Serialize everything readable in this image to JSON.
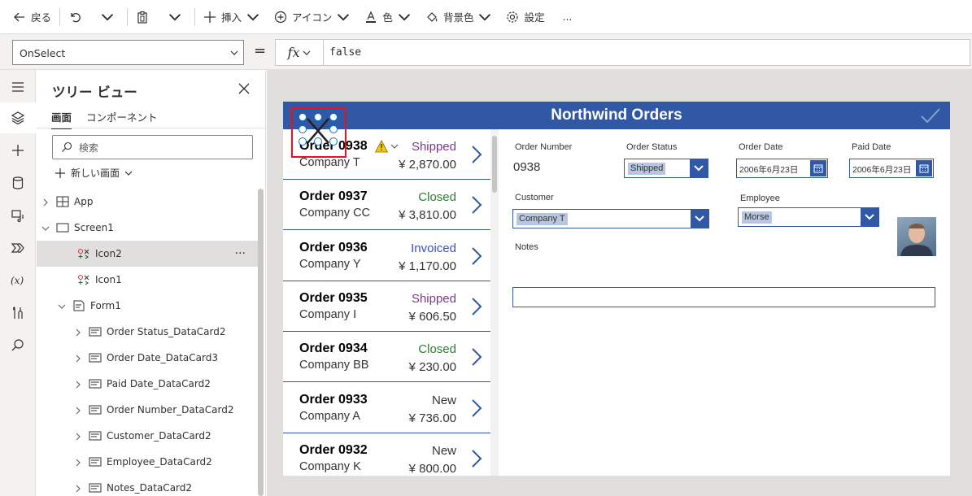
{
  "toolbar": {
    "back": "戻る",
    "insert": "挿入",
    "icon": "アイコン",
    "color": "色",
    "bgcolor": "背景色",
    "settings": "設定",
    "more": "..."
  },
  "formula_bar": {
    "property": "OnSelect",
    "equals": "=",
    "fx": "fx",
    "formula": "false"
  },
  "tree": {
    "title": "ツリー ビュー",
    "tabs": [
      "画面",
      "コンポーネント"
    ],
    "search_placeholder": "検索",
    "new_screen": "新しい画面",
    "nodes": [
      {
        "label": "App",
        "level": 0,
        "expander": "collapsed",
        "icon": "app-icon"
      },
      {
        "label": "Screen1",
        "level": 0,
        "expander": "expanded",
        "icon": "screen-icon"
      },
      {
        "label": "Icon2",
        "level": 1,
        "expander": "none",
        "icon": "icon-control-icon",
        "selected": true,
        "more": "···"
      },
      {
        "label": "Icon1",
        "level": 1,
        "expander": "none",
        "icon": "icon-control-icon"
      },
      {
        "label": "Form1",
        "level": 1,
        "expander": "expanded",
        "icon": "form-icon"
      },
      {
        "label": "Order Status_DataCard2",
        "level": 2,
        "expander": "collapsed",
        "icon": "datacard-icon"
      },
      {
        "label": "Order Date_DataCard3",
        "level": 2,
        "expander": "collapsed",
        "icon": "datacard-icon"
      },
      {
        "label": "Paid Date_DataCard2",
        "level": 2,
        "expander": "collapsed",
        "icon": "datacard-icon"
      },
      {
        "label": "Order Number_DataCard2",
        "level": 2,
        "expander": "collapsed",
        "icon": "datacard-icon"
      },
      {
        "label": "Customer_DataCard2",
        "level": 2,
        "expander": "collapsed",
        "icon": "datacard-icon"
      },
      {
        "label": "Employee_DataCard2",
        "level": 2,
        "expander": "collapsed",
        "icon": "datacard-icon"
      },
      {
        "label": "Notes_DataCard2",
        "level": 2,
        "expander": "collapsed",
        "icon": "datacard-icon"
      }
    ]
  },
  "app": {
    "title": "Northwind Orders",
    "orders": [
      {
        "title": "Order 0938",
        "company": "Company T",
        "status": "Shipped",
        "status_color": "#7a3a8c",
        "amount": "¥ 2,870.00",
        "warning": true
      },
      {
        "title": "Order 0937",
        "company": "Company CC",
        "status": "Closed",
        "status_color": "#2e7d32",
        "amount": "¥ 3,810.00"
      },
      {
        "title": "Order 0936",
        "company": "Company Y",
        "status": "Invoiced",
        "status_color": "#3a4fd1",
        "amount": "¥ 1,170.00"
      },
      {
        "title": "Order 0935",
        "company": "Company I",
        "status": "Shipped",
        "status_color": "#7a3a8c",
        "amount": "¥ 606.50"
      },
      {
        "title": "Order 0934",
        "company": "Company BB",
        "status": "Closed",
        "status_color": "#2e7d32",
        "amount": "¥ 230.00"
      },
      {
        "title": "Order 0933",
        "company": "Company A",
        "status": "New",
        "status_color": "#333333",
        "amount": "¥ 736.00"
      },
      {
        "title": "Order 0932",
        "company": "Company K",
        "status": "New",
        "status_color": "#333333",
        "amount": "¥ 800.00"
      }
    ],
    "form": {
      "order_number_label": "Order Number",
      "order_number": "0938",
      "order_status_label": "Order Status",
      "order_status": "Shipped",
      "order_date_label": "Order Date",
      "order_date": "2006年6月23日",
      "paid_date_label": "Paid Date",
      "paid_date": "2006年6月23日",
      "customer_label": "Customer",
      "customer": "Company T",
      "employee_label": "Employee",
      "employee": "Morse",
      "notes_label": "Notes",
      "notes": ""
    }
  }
}
